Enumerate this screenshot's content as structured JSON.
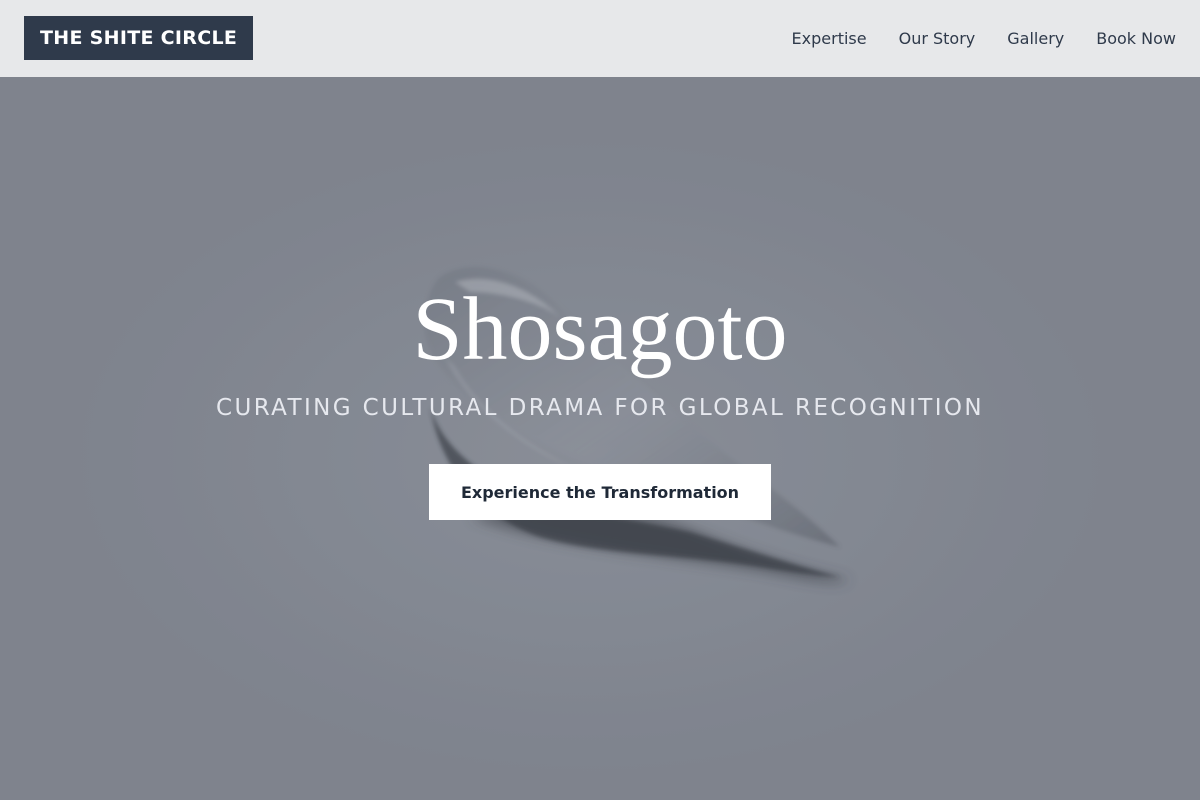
{
  "header": {
    "logo_text": "THE SHITE CIRCLE",
    "nav": [
      {
        "label": "Expertise"
      },
      {
        "label": "Our Story"
      },
      {
        "label": "Gallery"
      },
      {
        "label": "Book Now"
      }
    ]
  },
  "hero": {
    "title": "Shosagoto",
    "subtitle": "CURATING CULTURAL DRAMA FOR GLOBAL RECOGNITION",
    "cta_label": "Experience the Transformation"
  },
  "colors": {
    "header_bg": "#e7e8ea",
    "logo_bg": "#2f3a4b",
    "nav_text": "#2f3a4b",
    "hero_bg": "#838892",
    "cta_bg": "#ffffff",
    "cta_text": "#1f2937"
  }
}
